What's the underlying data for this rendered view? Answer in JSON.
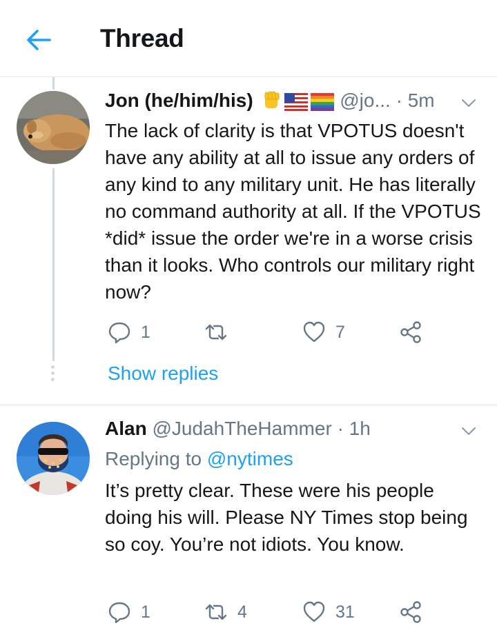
{
  "header": {
    "title": "Thread"
  },
  "tweets": [
    {
      "name": "Jon (he/him/his)",
      "handle": "@jo...",
      "separator": "·",
      "time": "5m",
      "text": "The lack of clarity is that VPOTUS doesn't have any ability at all to issue any orders of any kind to any military unit. He has literally no command authority at all. If the VPOTUS *did* issue the order we're in a worse crisis than it looks. Who controls our military right now?",
      "replies": "1",
      "retweets": "",
      "likes": "7",
      "show_replies": "Show replies",
      "emoji_icons": [
        "raised-fist",
        "us-flag",
        "rainbow-flag"
      ]
    },
    {
      "name": "Alan",
      "handle": "@JudahTheHammer",
      "separator": "·",
      "time": "1h",
      "replying_label": "Replying to",
      "replying_to": "@nytimes",
      "text": "It’s pretty clear. These were his people doing his will. Please NY Times stop being so coy. You’re not idiots. You know.",
      "replies": "1",
      "retweets": "4",
      "likes": "31"
    }
  ],
  "colors": {
    "accent": "#1da1f2",
    "text": "#14171a",
    "muted": "#657786",
    "border": "#e1e8ed"
  }
}
